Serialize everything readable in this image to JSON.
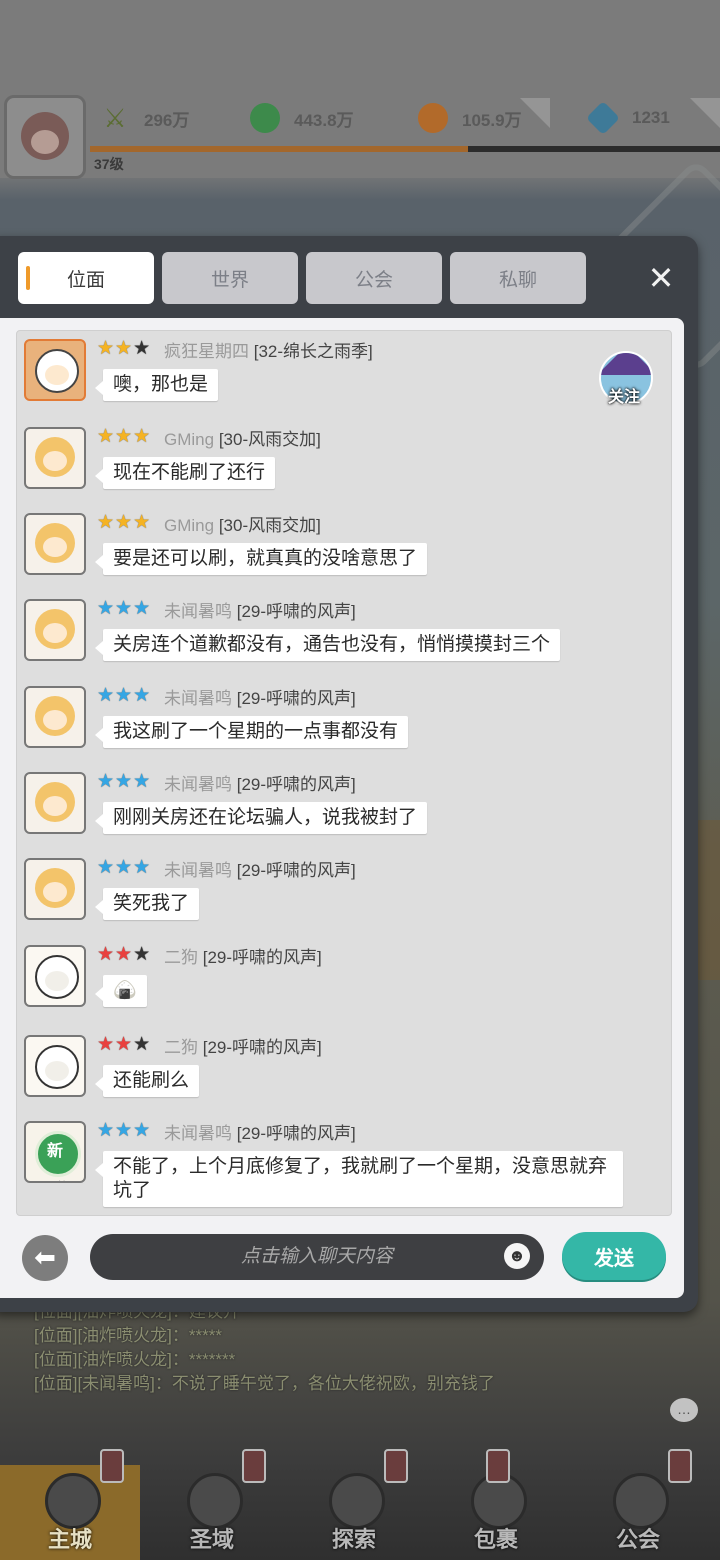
{
  "hud": {
    "power": "296万",
    "jade": "443.8万",
    "gold": "105.9万",
    "gem": "1231",
    "level": "37级",
    "xp_fraction": 0.6
  },
  "tabs": [
    {
      "label": "位面",
      "active": true
    },
    {
      "label": "世界",
      "active": false
    },
    {
      "label": "公会",
      "active": false
    },
    {
      "label": "私聊",
      "active": false
    }
  ],
  "close_label": "✕",
  "follow_label": "关注",
  "messages": [
    {
      "stars": "gold-gold-dark",
      "name": "疯狂星期四",
      "guild": "[32-绵长之雨季]",
      "text": "噢，那也是",
      "avatar": "monster"
    },
    {
      "stars": "gold-gold-gold",
      "name": "GMing",
      "guild": "[30-风雨交加]",
      "text": "现在不能刷了还行",
      "avatar": "blonde"
    },
    {
      "stars": "gold-gold-gold",
      "name": "GMing",
      "guild": "[30-风雨交加]",
      "text": "要是还可以刷，就真真的没啥意思了",
      "avatar": "blonde"
    },
    {
      "stars": "blue-blue-blue",
      "name": "未闻暑鸣",
      "guild": "[29-呼啸的风声]",
      "text": "关房连个道歉都没有，通告也没有，悄悄摸摸封三个",
      "avatar": "blonde"
    },
    {
      "stars": "blue-blue-blue",
      "name": "未闻暑鸣",
      "guild": "[29-呼啸的风声]",
      "text": "我这刷了一个星期的一点事都没有",
      "avatar": "blonde"
    },
    {
      "stars": "blue-blue-blue",
      "name": "未闻暑鸣",
      "guild": "[29-呼啸的风声]",
      "text": "刚刚关房还在论坛骗人，说我被封了",
      "avatar": "blonde"
    },
    {
      "stars": "blue-blue-blue",
      "name": "未闻暑鸣",
      "guild": "[29-呼啸的风声]",
      "text": "笑死我了",
      "avatar": "blonde"
    },
    {
      "stars": "red-red-dark",
      "name": "二狗",
      "guild": "[29-呼啸的风声]",
      "text": "🍙",
      "avatar": "rabbit"
    },
    {
      "stars": "red-red-dark",
      "name": "二狗",
      "guild": "[29-呼啸的风声]",
      "text": "还能刷么",
      "avatar": "rabbit"
    },
    {
      "stars": "blue-blue-blue",
      "name": "未闻暑鸣",
      "guild": "[29-呼啸的风声]",
      "text": "不能了，上个月底修复了，我就刷了一个星期，没意思就弃坑了",
      "avatar": "newbie",
      "avatar_badge": "新"
    }
  ],
  "input": {
    "placeholder": "点击输入聊天内容"
  },
  "send_label": "发送",
  "background_log": [
    "[位面][油炸喷火龙]：建议开**",
    "[位面][油炸喷火龙]：*****",
    "[位面][油炸喷火龙]：*******",
    "[位面][未闻暑鸣]：不说了睡午觉了，各位大佬祝欧，别充钱了"
  ],
  "bottom_nav": [
    {
      "label": "主城",
      "active": true
    },
    {
      "label": "圣域",
      "active": false
    },
    {
      "label": "探索",
      "active": false
    },
    {
      "label": "包裹",
      "active": false
    },
    {
      "label": "公会",
      "active": false
    }
  ],
  "colors": {
    "accent_tab": "#ef9a2a",
    "send": "#34b7a7",
    "panel": "#3d4147"
  }
}
